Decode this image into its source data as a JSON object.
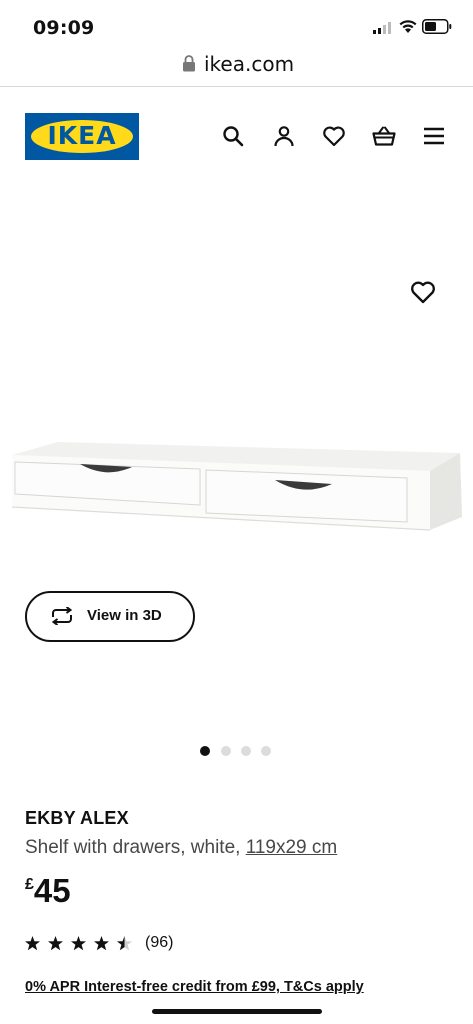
{
  "status_bar": {
    "time": "09:09"
  },
  "browser": {
    "url": "ikea.com"
  },
  "header": {
    "logo_text": "IKEA",
    "icons": [
      "search-icon",
      "user-icon",
      "heart-icon",
      "basket-icon",
      "menu-icon"
    ]
  },
  "gallery": {
    "view_3d_label": "View in 3D",
    "image_count": 4,
    "active_image": 1
  },
  "product": {
    "name": "EKBY ALEX",
    "description": "Shelf with drawers, white, ",
    "size": "119x29 cm",
    "currency": "£",
    "price": "45",
    "rating": 4.5,
    "reviews": "(96)",
    "credit_text": "0% APR Interest-free credit from £99, T&Cs apply"
  },
  "colors": {
    "ikea_blue": "#0058a3",
    "ikea_yellow": "#ffda1a"
  }
}
